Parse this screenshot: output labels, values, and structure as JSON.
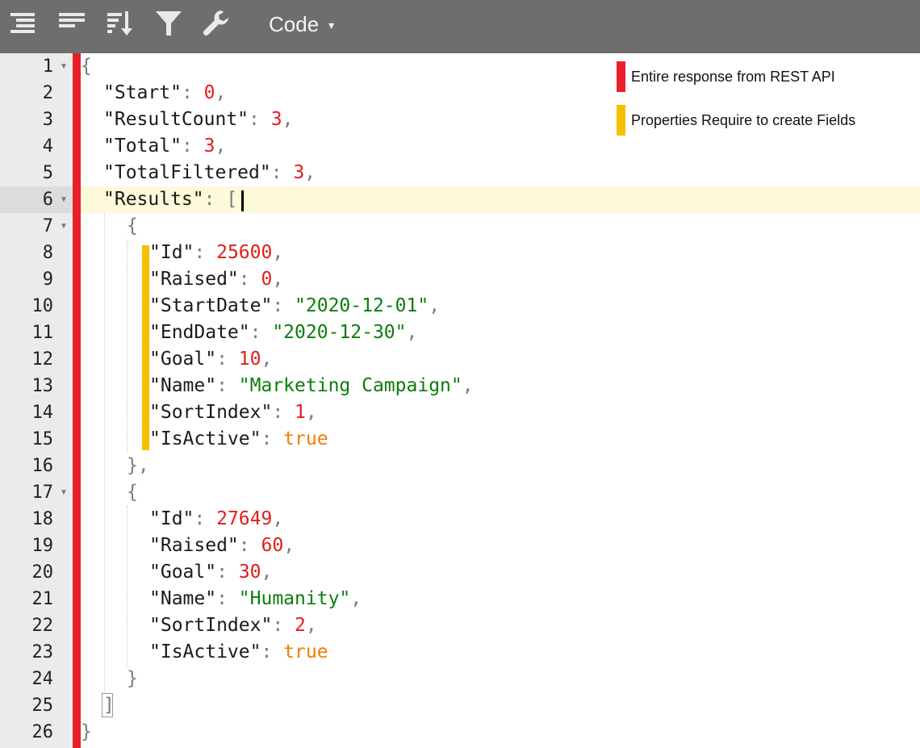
{
  "toolbar": {
    "buttons": [
      {
        "name": "format-icon"
      },
      {
        "name": "compact-icon"
      },
      {
        "name": "sort-icon"
      },
      {
        "name": "filter-icon"
      },
      {
        "name": "repair-icon"
      }
    ],
    "mode_label": "Code",
    "mode_caret": "▾"
  },
  "colors": {
    "red_bar": "#e8202a",
    "yellow_bar": "#f6c000",
    "number": "#e31c1c",
    "string": "#0a7d0a",
    "boolean": "#f07d00"
  },
  "legend": [
    {
      "label": "Entire response from REST API",
      "color": "#e8202a"
    },
    {
      "label": "Properties Require to create Fields",
      "color": "#f6c000"
    }
  ],
  "editor": {
    "active_line": 6,
    "lines": [
      {
        "num": "1",
        "fold": true,
        "tokens": [
          [
            "p",
            "{"
          ]
        ]
      },
      {
        "num": "2",
        "tokens": [
          [
            "k",
            "\"Start\""
          ],
          [
            "p",
            ": "
          ],
          [
            "n",
            "0"
          ],
          [
            "p",
            ","
          ]
        ]
      },
      {
        "num": "3",
        "tokens": [
          [
            "k",
            "\"ResultCount\""
          ],
          [
            "p",
            ": "
          ],
          [
            "n",
            "3"
          ],
          [
            "p",
            ","
          ]
        ]
      },
      {
        "num": "4",
        "tokens": [
          [
            "k",
            "\"Total\""
          ],
          [
            "p",
            ": "
          ],
          [
            "n",
            "3"
          ],
          [
            "p",
            ","
          ]
        ]
      },
      {
        "num": "5",
        "tokens": [
          [
            "k",
            "\"TotalFiltered\""
          ],
          [
            "p",
            ": "
          ],
          [
            "n",
            "3"
          ],
          [
            "p",
            ","
          ]
        ]
      },
      {
        "num": "6",
        "fold": true,
        "tokens": [
          [
            "k",
            "\"Results\""
          ],
          [
            "p",
            ": ["
          ]
        ]
      },
      {
        "num": "7",
        "fold": true,
        "tokens": [
          [
            "p",
            "{"
          ]
        ]
      },
      {
        "num": "8",
        "tokens": [
          [
            "k",
            "\"Id\""
          ],
          [
            "p",
            ": "
          ],
          [
            "n",
            "25600"
          ],
          [
            "p",
            ","
          ]
        ]
      },
      {
        "num": "9",
        "tokens": [
          [
            "k",
            "\"Raised\""
          ],
          [
            "p",
            ": "
          ],
          [
            "n",
            "0"
          ],
          [
            "p",
            ","
          ]
        ]
      },
      {
        "num": "10",
        "tokens": [
          [
            "k",
            "\"StartDate\""
          ],
          [
            "p",
            ": "
          ],
          [
            "s",
            "\"2020-12-01\""
          ],
          [
            "p",
            ","
          ]
        ]
      },
      {
        "num": "11",
        "tokens": [
          [
            "k",
            "\"EndDate\""
          ],
          [
            "p",
            ": "
          ],
          [
            "s",
            "\"2020-12-30\""
          ],
          [
            "p",
            ","
          ]
        ]
      },
      {
        "num": "12",
        "tokens": [
          [
            "k",
            "\"Goal\""
          ],
          [
            "p",
            ": "
          ],
          [
            "n",
            "10"
          ],
          [
            "p",
            ","
          ]
        ]
      },
      {
        "num": "13",
        "tokens": [
          [
            "k",
            "\"Name\""
          ],
          [
            "p",
            ": "
          ],
          [
            "s",
            "\"Marketing Campaign\""
          ],
          [
            "p",
            ","
          ]
        ]
      },
      {
        "num": "14",
        "tokens": [
          [
            "k",
            "\"SortIndex\""
          ],
          [
            "p",
            ": "
          ],
          [
            "n",
            "1"
          ],
          [
            "p",
            ","
          ]
        ]
      },
      {
        "num": "15",
        "tokens": [
          [
            "k",
            "\"IsActive\""
          ],
          [
            "p",
            ": "
          ],
          [
            "b",
            "true"
          ]
        ]
      },
      {
        "num": "16",
        "tokens": [
          [
            "p",
            "},"
          ]
        ]
      },
      {
        "num": "17",
        "fold": true,
        "tokens": [
          [
            "p",
            "{"
          ]
        ]
      },
      {
        "num": "18",
        "tokens": [
          [
            "k",
            "\"Id\""
          ],
          [
            "p",
            ": "
          ],
          [
            "n",
            "27649"
          ],
          [
            "p",
            ","
          ]
        ]
      },
      {
        "num": "19",
        "tokens": [
          [
            "k",
            "\"Raised\""
          ],
          [
            "p",
            ": "
          ],
          [
            "n",
            "60"
          ],
          [
            "p",
            ","
          ]
        ]
      },
      {
        "num": "20",
        "tokens": [
          [
            "k",
            "\"Goal\""
          ],
          [
            "p",
            ": "
          ],
          [
            "n",
            "30"
          ],
          [
            "p",
            ","
          ]
        ]
      },
      {
        "num": "21",
        "tokens": [
          [
            "k",
            "\"Name\""
          ],
          [
            "p",
            ": "
          ],
          [
            "s",
            "\"Humanity\""
          ],
          [
            "p",
            ","
          ]
        ]
      },
      {
        "num": "22",
        "tokens": [
          [
            "k",
            "\"SortIndex\""
          ],
          [
            "p",
            ": "
          ],
          [
            "n",
            "2"
          ],
          [
            "p",
            ","
          ]
        ]
      },
      {
        "num": "23",
        "tokens": [
          [
            "k",
            "\"IsActive\""
          ],
          [
            "p",
            ": "
          ],
          [
            "b",
            "true"
          ]
        ]
      },
      {
        "num": "24",
        "tokens": [
          [
            "p",
            "}"
          ]
        ]
      },
      {
        "num": "25",
        "tokens": [
          [
            "p",
            "]"
          ]
        ]
      },
      {
        "num": "26",
        "tokens": [
          [
            "p",
            "}"
          ]
        ]
      }
    ]
  }
}
